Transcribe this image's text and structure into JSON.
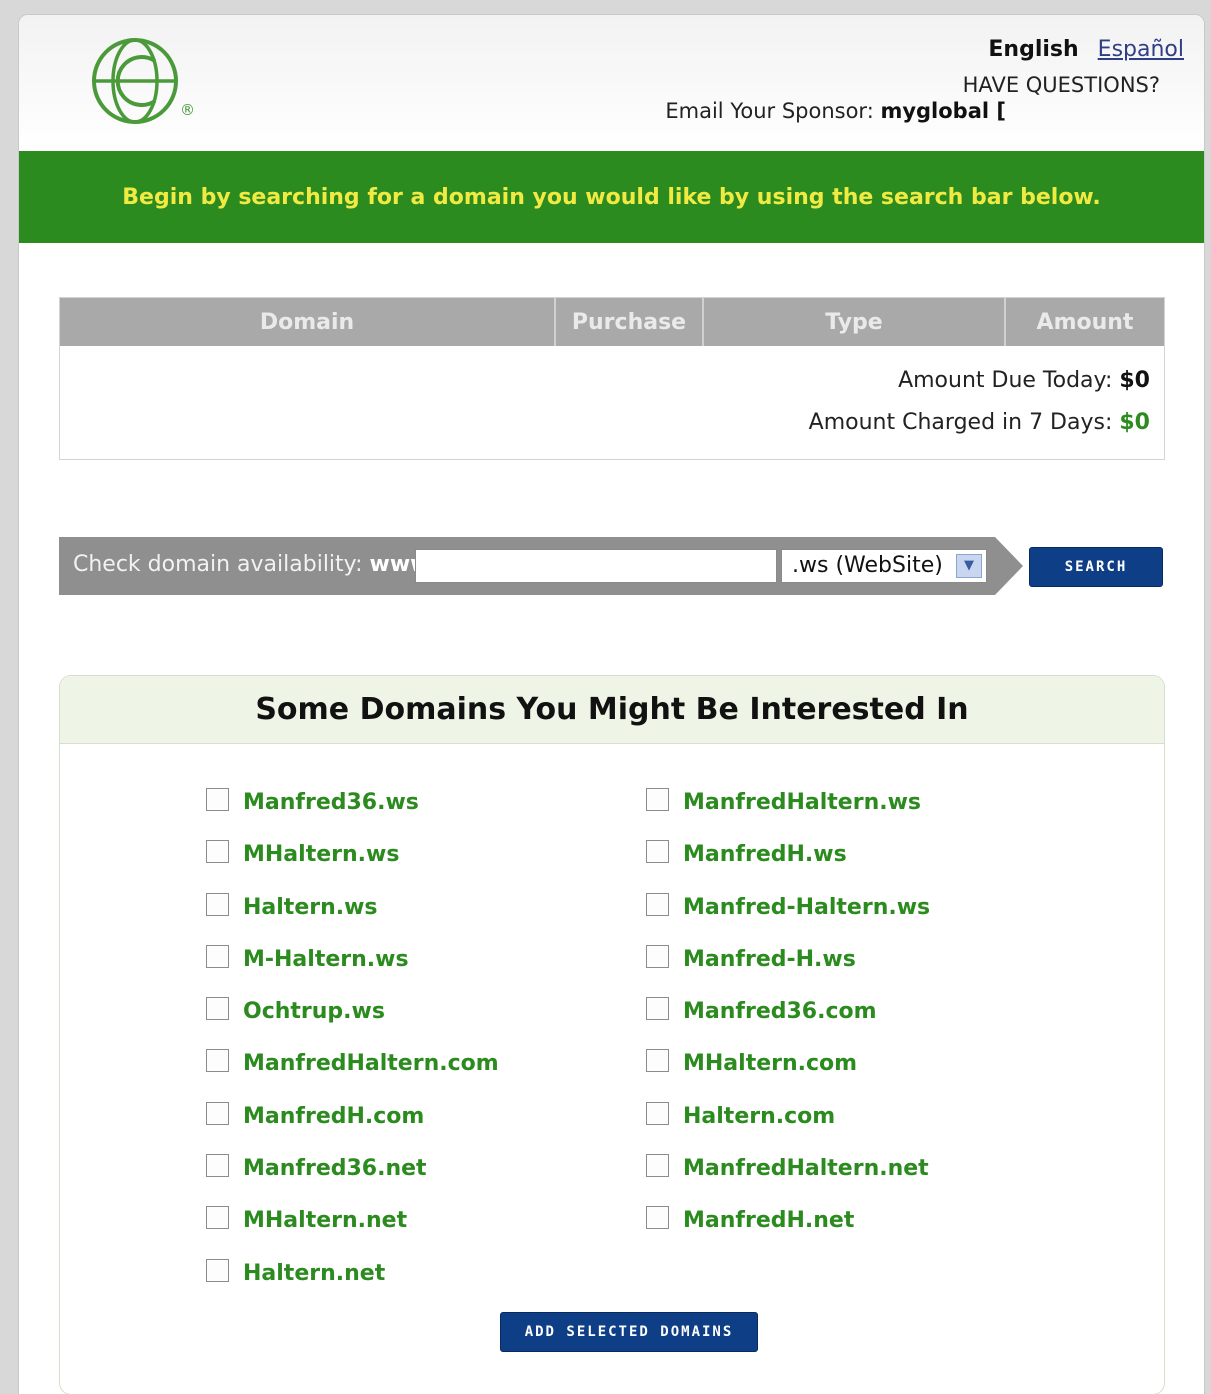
{
  "header": {
    "lang_active": "English",
    "lang_alt": "Español",
    "questions": "HAVE QUESTIONS?",
    "sponsor_label": "Email Your Sponsor:",
    "sponsor_name": "myglobal ["
  },
  "banner": {
    "text": "Begin by searching for a domain you would like by using the search bar below."
  },
  "cart": {
    "columns": [
      "Domain",
      "Purchase",
      "Type",
      "Amount"
    ],
    "due_label": "Amount Due Today:",
    "due_value": "$0",
    "charged_label": "Amount Charged in 7 Days:",
    "charged_value": "$0"
  },
  "search": {
    "label": "Check domain availability:",
    "prefix": "www.",
    "input_value": "",
    "tld_selected": ".ws (WebSite)",
    "button_label": "SEARCH"
  },
  "suggestions": {
    "title": "Some Domains You Might Be Interested In",
    "left": [
      "Manfred36.ws",
      "MHaltern.ws",
      "Haltern.ws",
      "M-Haltern.ws",
      "Ochtrup.ws",
      "ManfredHaltern.com",
      "ManfredH.com",
      "Manfred36.net",
      "MHaltern.net",
      "Haltern.net"
    ],
    "right": [
      "ManfredHaltern.ws",
      "ManfredH.ws",
      "Manfred-Haltern.ws",
      "Manfred-H.ws",
      "Manfred36.com",
      "MHaltern.com",
      "Haltern.com",
      "ManfredHaltern.net",
      "ManfredH.net"
    ],
    "add_button": "ADD SELECTED DOMAINS"
  },
  "colors": {
    "brand_green": "#2c8b1f",
    "banner_text": "#f1ea42",
    "button_blue": "#0e3f86"
  },
  "icons": {
    "logo": "globe-logo-icon",
    "registered": "registered-mark-icon",
    "dropdown": "chevron-down-icon"
  }
}
